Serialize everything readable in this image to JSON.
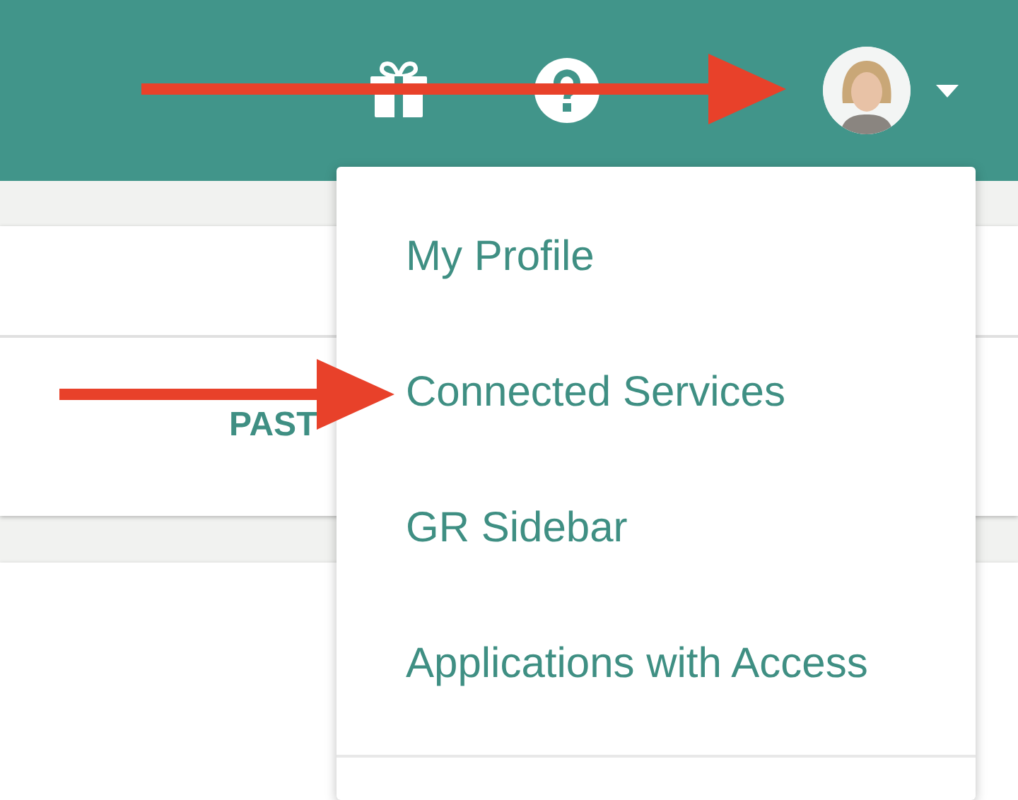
{
  "cards": [
    {
      "kind": "split",
      "label": "PAST"
    },
    {
      "kind": "plain"
    }
  ],
  "menu": {
    "items": [
      {
        "label": "My Profile"
      },
      {
        "label": "Connected Services"
      },
      {
        "label": "GR Sidebar"
      },
      {
        "label": "Applications with Access"
      }
    ]
  },
  "annotations": [
    {
      "kind": "arrow"
    },
    {
      "kind": "arrow"
    }
  ]
}
